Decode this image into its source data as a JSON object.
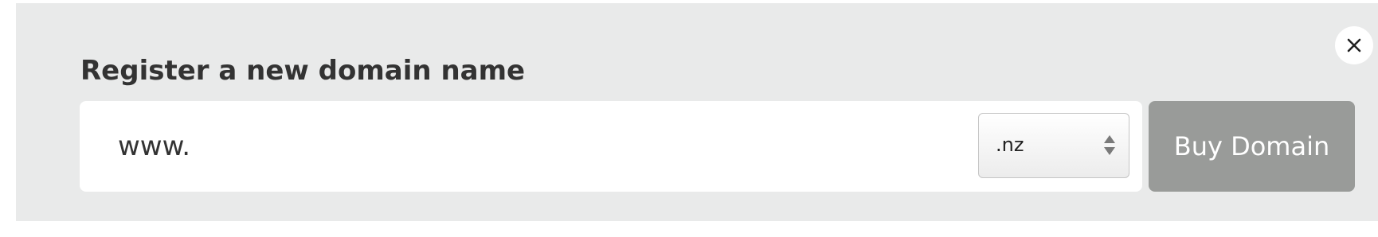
{
  "register": {
    "heading": "Register a new domain name",
    "input_value": "www.",
    "tld_selected": ".nz",
    "buy_label": "Buy Domain"
  },
  "icons": {
    "close": "close-icon",
    "select": "select-arrows-icon"
  },
  "colors": {
    "panel_bg": "#e9eaea",
    "buy_button_bg": "#999b99",
    "heading_text": "#333333"
  }
}
